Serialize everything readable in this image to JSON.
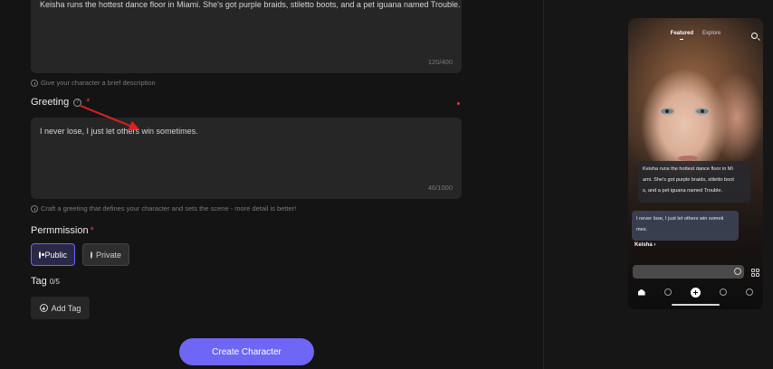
{
  "description": {
    "value": "Keisha runs the hottest dance floor in Miami. She's got purple braids, stiletto boots, and a pet iguana named Trouble.",
    "counter": "120/400",
    "helper": "Give your character a brief description"
  },
  "greeting": {
    "label": "Greeting",
    "required_mark": "*",
    "value": "I never lose, I just let others win sometimes.",
    "counter": "46/1000",
    "helper": "Craft a greeting that defines your character and sets the scene - more detail is better!"
  },
  "permission": {
    "label": "Permmission",
    "required_mark": "*",
    "options": [
      "Public",
      "Private"
    ],
    "selected": "Public"
  },
  "tags": {
    "label": "Tag",
    "count": "0/5",
    "add_label": "Add Tag"
  },
  "create_button": "Create Character",
  "preview": {
    "tabs": [
      "Featured",
      "Explore"
    ],
    "active_tab": "Featured",
    "bubble_description_lines": [
      "Keisha runs the hottest dance floor in Mi",
      "ami. She's got purple braids, stiletto boot",
      "s, and a pet iguana named Trouble."
    ],
    "bubble_greeting_lines": [
      "I never lose, I just let others win someti",
      "mes."
    ],
    "character_name": "Keisha",
    "character_name_suffix": "›"
  },
  "colors": {
    "accent": "#6e66f5",
    "required": "#e03a3a",
    "annotation_arrow": "#e02020"
  },
  "icons": [
    "info-icon",
    "hint-icon",
    "radio-icon",
    "plus-circle-icon",
    "search-icon",
    "grid-icon",
    "home-icon",
    "chat-icon",
    "plus-icon",
    "compass-icon",
    "profile-icon"
  ]
}
